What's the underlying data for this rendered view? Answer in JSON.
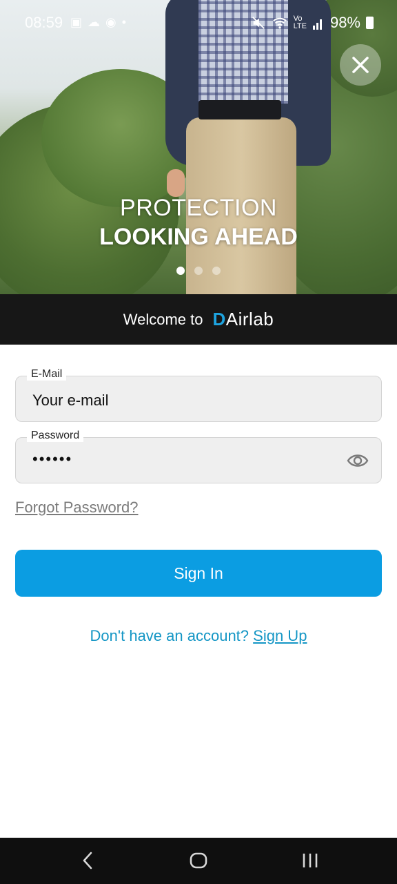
{
  "status_bar": {
    "time": "08:59",
    "battery": "98%"
  },
  "hero": {
    "slogan_line1": "PROTECTION",
    "slogan_line2": "LOOKING AHEAD",
    "carousel_total": 3,
    "carousel_active": 1
  },
  "welcome": {
    "text": "Welcome to",
    "logo_prefix": "D",
    "logo_rest": "Airlab"
  },
  "form": {
    "email_label": "E-Mail",
    "email_placeholder": "Your e-mail",
    "password_label": "Password",
    "password_value": "••••••",
    "forgot_label": "Forgot Password?",
    "signin_label": "Sign In",
    "no_account_text": "Don't have an account?",
    "signup_label": "Sign Up"
  },
  "icons": {
    "close": "close-icon",
    "eye": "eye-icon",
    "back": "back-icon",
    "home": "home-icon",
    "recents": "recents-icon"
  },
  "colors": {
    "accent": "#0b9de2",
    "link": "#1496c5",
    "welcome_bar": "#171717",
    "logo_accent": "#1ea4e0"
  }
}
